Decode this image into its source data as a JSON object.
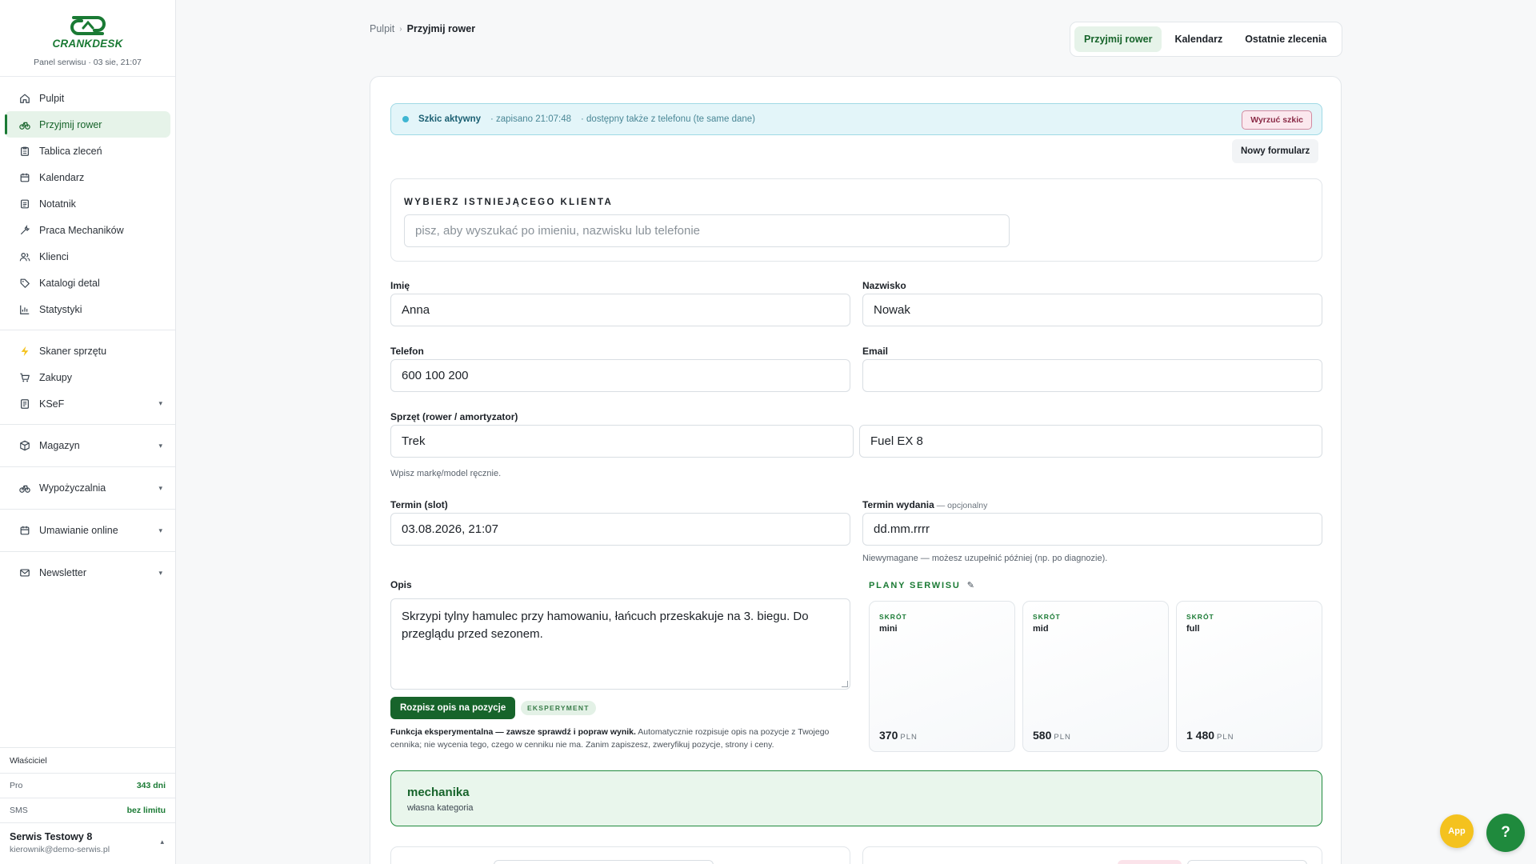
{
  "brand": {
    "name": "CRANKDESK",
    "subtitle": "Panel serwisu · 03 sie, 21:07"
  },
  "nav": {
    "items": [
      {
        "label": "Pulpit",
        "icon": "home-icon"
      },
      {
        "label": "Przyjmij rower",
        "icon": "bike-icon",
        "active": true
      },
      {
        "label": "Tablica zleceń",
        "icon": "clipboard-icon"
      },
      {
        "label": "Kalendarz",
        "icon": "calendar-icon"
      },
      {
        "label": "Notatnik",
        "icon": "notebook-icon"
      },
      {
        "label": "Praca Mechaników",
        "icon": "wrench-icon"
      },
      {
        "label": "Klienci",
        "icon": "users-icon"
      },
      {
        "label": "Katalogi detal",
        "icon": "tag-icon"
      },
      {
        "label": "Statystyki",
        "icon": "bar-chart-icon"
      }
    ],
    "tools": [
      {
        "label": "Skaner sprzętu",
        "icon": "bolt-icon"
      },
      {
        "label": "Zakupy",
        "icon": "cart-icon"
      },
      {
        "label": "KSeF",
        "icon": "document-icon",
        "caret": "▾"
      }
    ],
    "groups": [
      {
        "label": "Magazyn",
        "icon": "box-icon",
        "caret": "▾"
      },
      {
        "label": "Wypożyczalnia",
        "icon": "bike-icon",
        "caret": "▾"
      },
      {
        "label": "Umawianie online",
        "icon": "calendar-icon",
        "caret": "▾"
      },
      {
        "label": "Newsletter",
        "icon": "mail-icon",
        "caret": "▾"
      }
    ]
  },
  "account": {
    "role": "Właściciel",
    "plan_label": "Pro",
    "plan_value": "343 dni",
    "sms_label": "SMS",
    "sms_value": "bez limitu",
    "name": "Serwis Testowy 8",
    "email": "kierownik@demo-serwis.pl",
    "caret": "▴"
  },
  "breadcrumb": {
    "root": "Pulpit",
    "sep": "›",
    "current": "Przyjmij rower"
  },
  "tabs": [
    {
      "label": "Przyjmij rower",
      "active": true
    },
    {
      "label": "Kalendarz"
    },
    {
      "label": "Ostatnie zlecenia"
    }
  ],
  "draft": {
    "title": "Szkic aktywny",
    "saved": "· zapisano 21:07:48",
    "mobile": "· dostępny także z telefonu (te same dane)",
    "discard": "Wyrzuć szkic",
    "new_form": "Nowy formularz"
  },
  "client_search": {
    "heading": "WYBIERZ ISTNIEJĄCEGO KLIENTA",
    "placeholder": "pisz, aby wyszukać po imieniu, nazwisku lub telefonie"
  },
  "form": {
    "first_name_label": "Imię",
    "first_name": "Anna",
    "last_name_label": "Nazwisko",
    "last_name": "Nowak",
    "phone_label": "Telefon",
    "phone": "600 100 200",
    "email_label": "Email",
    "email": "",
    "equipment_label": "Sprzęt (rower / amortyzator)",
    "brand": "Trek",
    "model": "Fuel EX 8",
    "equipment_hint": "Wpisz markę/model ręcznie.",
    "slot_label": "Termin (slot)",
    "slot": "03.08.2026, 21:07",
    "release_label": "Termin wydania",
    "release_optional": " — opcjonalny",
    "release_placeholder": "dd.mm.rrrr",
    "release_hint": "Niewymagane — możesz uzupełnić później (np. po diagnozie).",
    "desc_label": "Opis",
    "desc": "Skrzypi tylny hamulec przy hamowaniu, łańcuch przeskakuje na 3. biegu. Do przeglądu przed sezonem.",
    "split_button": "Rozpisz opis na pozycje",
    "experiment_pill": "EKSPERYMENT",
    "note_bold": "Funkcja eksperymentalna — zawsze sprawdź i popraw wynik.",
    "note_rest": " Automatycznie rozpisuje opis na pozycje z Twojego cennika; nie wycenia tego, czego w cenniku nie ma. Zanim zapiszesz, zweryfikuj pozycje, strony i ceny."
  },
  "plans": {
    "heading": "PLANY SERWISU",
    "edit_glyph": "✎",
    "items": [
      {
        "short": "SKRÓT",
        "name": "mini",
        "price": "370",
        "currency": "PLN"
      },
      {
        "short": "SKRÓT",
        "name": "mid",
        "price": "580",
        "currency": "PLN"
      },
      {
        "short": "SKRÓT",
        "name": "full",
        "price": "1 480",
        "currency": "PLN"
      }
    ]
  },
  "category": {
    "title": "mechanika",
    "subtitle": "własna kategoria"
  },
  "fab": {
    "app": "App",
    "help": "?"
  },
  "colors": {
    "accent": "#1a7a34",
    "accent_bg": "#e6f3e9",
    "draft_bg": "#e3f5f9",
    "app_fab": "#f4c21e"
  }
}
